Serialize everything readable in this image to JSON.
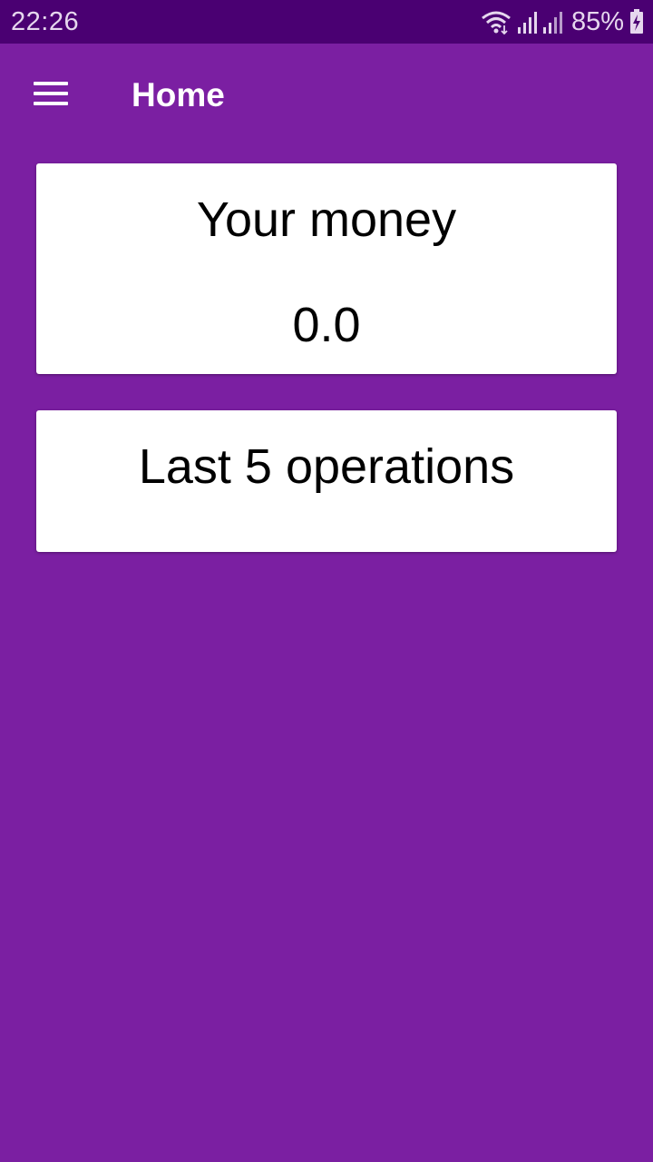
{
  "status_bar": {
    "time": "22:26",
    "battery": "85%",
    "icons": [
      "wifi-icon",
      "signal-icon",
      "signal-icon",
      "battery-charging-icon"
    ]
  },
  "app_bar": {
    "title": "Home",
    "menu_icon": "hamburger-menu-icon"
  },
  "money_card": {
    "title": "Your money",
    "value": "0.0"
  },
  "operations_card": {
    "title": "Last 5 operations"
  },
  "colors": {
    "background": "#7b1fa2",
    "status_bar": "#4a0072",
    "card": "#ffffff",
    "text_on_card": "#000000",
    "text_on_primary": "#ffffff"
  }
}
